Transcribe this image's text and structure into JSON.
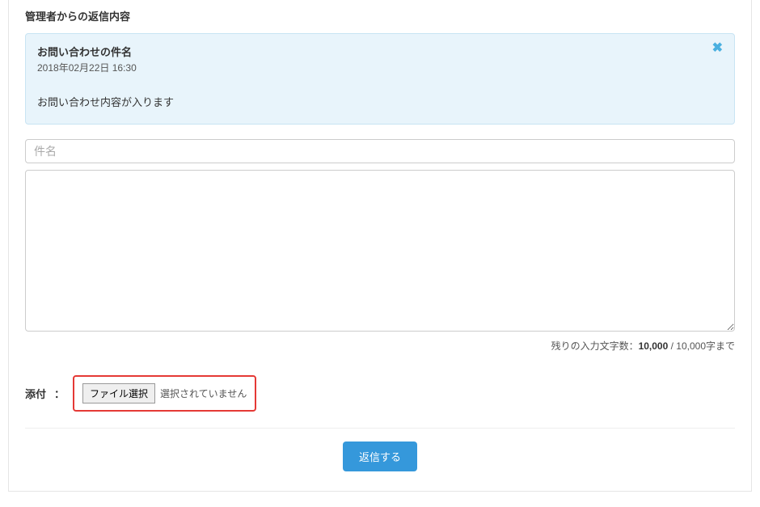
{
  "section_title": "管理者からの返信内容",
  "inquiry": {
    "subject": "お問い合わせの件名",
    "timestamp": "2018年02月22日 16:30",
    "body": "お問い合わせ内容が入ります"
  },
  "form": {
    "subject_placeholder": "件名",
    "subject_value": "",
    "body_value": "",
    "counter_prefix": "残りの入力文字数：",
    "counter_remaining": "10,000",
    "counter_suffix": " / 10,000字まで"
  },
  "attachment": {
    "label": "添付",
    "colon": "：",
    "button_label": "ファイル選択",
    "status": "選択されていません"
  },
  "actions": {
    "submit_label": "返信する"
  }
}
